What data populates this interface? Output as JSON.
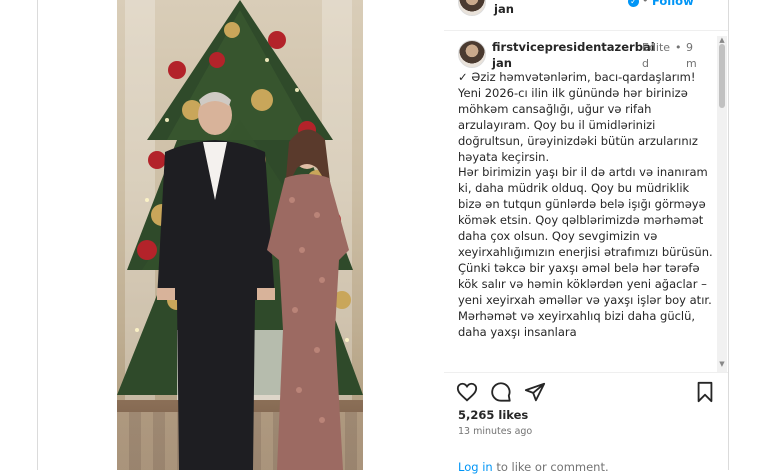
{
  "post": {
    "header": {
      "username_tail": "jan",
      "follow_label": "Follow"
    },
    "comment": {
      "username_line1": "firstvicepresidentazerbai",
      "username_line2": "jan",
      "edited_label": "Edite",
      "edited_tail": "d",
      "time_num": "9",
      "time_unit": "m",
      "paragraphs": [
        "✓ Əziz həmvətənlərim, bacı-qardaşlarım!",
        "Yeni 2026-cı ilin ilk günündə hər birinizə möhkəm cansağlığı, uğur və rifah arzulayıram. Qoy bu il ümidlərinizi doğrultsun, ürəyinizdəki bütün arzularınız həyata keçirsin.",
        "Hər birimizin yaşı bir il də artdı və inanıram ki, daha müdrik olduq. Qoy bu müdriklik bizə ən tutqun günlərdə belə işığı görməyə kömək etsin. Qoy qəlblərimizdə mərhəmət daha çox olsun. Qoy sevgimizin və xeyirxahlığımızın enerjisi ətrafımızı bürüsün.",
        "Çünki təkcə bir yaxşı əməl belə hər tərəfə kök salır və həmin köklərdən yeni ağaclar – yeni xeyirxah əməllər və yaxşı işlər boy atır. Mərhəmət və xeyirxahlıq bizi daha güclü, daha yaxşı insanlara"
      ]
    },
    "likes": "5,265 likes",
    "time_ago": "13 minutes ago",
    "login": {
      "link": "Log in",
      "rest": " to like or comment."
    }
  },
  "icons": [
    "heart-icon",
    "comment-icon",
    "share-icon",
    "bookmark-icon",
    "verified-icon"
  ],
  "colors": {
    "link_blue": "#0095f6",
    "verified_blue": "#0095f6",
    "muted": "#737373"
  }
}
